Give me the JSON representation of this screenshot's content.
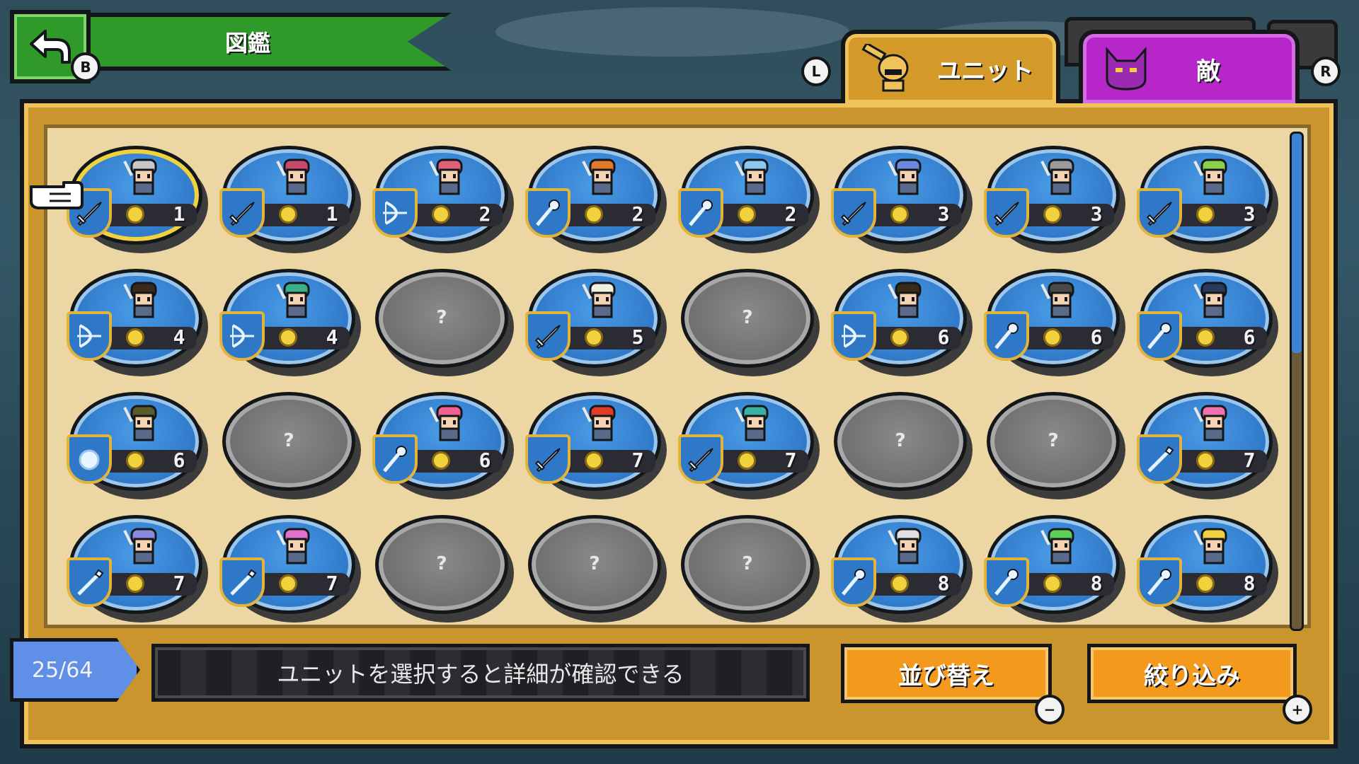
{
  "header": {
    "title": "図鑑",
    "back_key": "B"
  },
  "tabs": [
    {
      "label": "ユニット",
      "key": "L",
      "active": true,
      "color": "#d39a2a"
    },
    {
      "label": "敵",
      "key": "R",
      "active": false,
      "color": "#b726c9"
    }
  ],
  "units": [
    {
      "cost": "1",
      "locked": false,
      "selected": true,
      "class_icon": "sword-icon",
      "hair": "#c8c8c8"
    },
    {
      "cost": "1",
      "locked": false,
      "class_icon": "sword-icon",
      "hair": "#c84a6a"
    },
    {
      "cost": "2",
      "locked": false,
      "class_icon": "bow-icon",
      "hair": "#e0607a"
    },
    {
      "cost": "2",
      "locked": false,
      "class_icon": "staff-icon",
      "hair": "#e07a2a"
    },
    {
      "cost": "2",
      "locked": false,
      "class_icon": "staff-icon",
      "hair": "#8ac8f0"
    },
    {
      "cost": "3",
      "locked": false,
      "class_icon": "sword-icon",
      "hair": "#6a8ae0"
    },
    {
      "cost": "3",
      "locked": false,
      "class_icon": "sword-icon",
      "hair": "#9a9a9a"
    },
    {
      "cost": "3",
      "locked": false,
      "class_icon": "sword-icon",
      "hair": "#8ad04a"
    },
    {
      "cost": "4",
      "locked": false,
      "class_icon": "bow-icon",
      "hair": "#3a2a1a"
    },
    {
      "cost": "4",
      "locked": false,
      "class_icon": "bow-icon",
      "hair": "#3ab08a"
    },
    {
      "cost": "",
      "locked": true,
      "label": "?"
    },
    {
      "cost": "5",
      "locked": false,
      "class_icon": "sword-icon",
      "hair": "#f0f0e0"
    },
    {
      "cost": "",
      "locked": true,
      "label": "?"
    },
    {
      "cost": "6",
      "locked": false,
      "class_icon": "bow-icon",
      "hair": "#3a2a1a"
    },
    {
      "cost": "6",
      "locked": false,
      "class_icon": "staff-icon",
      "hair": "#4a4a4a"
    },
    {
      "cost": "6",
      "locked": false,
      "class_icon": "staff-icon",
      "hair": "#2a3a5a"
    },
    {
      "cost": "6",
      "locked": false,
      "class_icon": "orb-icon",
      "hair": "#5a5a2a"
    },
    {
      "cost": "",
      "locked": true,
      "label": "?"
    },
    {
      "cost": "6",
      "locked": false,
      "class_icon": "staff-icon",
      "hair": "#f06090"
    },
    {
      "cost": "7",
      "locked": false,
      "class_icon": "sword-icon",
      "hair": "#e03a2a"
    },
    {
      "cost": "7",
      "locked": false,
      "class_icon": "sword-icon",
      "hair": "#3ab0a0"
    },
    {
      "cost": "",
      "locked": true,
      "label": "?"
    },
    {
      "cost": "",
      "locked": true,
      "label": "?"
    },
    {
      "cost": "7",
      "locked": false,
      "class_icon": "spear-icon",
      "hair": "#f070b0"
    },
    {
      "cost": "7",
      "locked": false,
      "class_icon": "spear-icon",
      "hair": "#8a8ae0"
    },
    {
      "cost": "7",
      "locked": false,
      "class_icon": "spear-icon",
      "hair": "#e070d0"
    },
    {
      "cost": "",
      "locked": true,
      "label": "?"
    },
    {
      "cost": "",
      "locked": true,
      "label": "?"
    },
    {
      "cost": "",
      "locked": true,
      "label": "?"
    },
    {
      "cost": "8",
      "locked": false,
      "class_icon": "staff-icon",
      "hair": "#e0e0e0"
    },
    {
      "cost": "8",
      "locked": false,
      "class_icon": "staff-icon",
      "hair": "#5ad05a"
    },
    {
      "cost": "8",
      "locked": false,
      "class_icon": "staff-icon",
      "hair": "#f0d040"
    }
  ],
  "footer": {
    "counter": "25/64",
    "hint": "ユニットを選択すると詳細が確認できる",
    "sort_label": "並び替え",
    "sort_key": "−",
    "filter_label": "絞り込み",
    "filter_key": "+"
  },
  "scrollbar": {
    "position": 0.0
  }
}
